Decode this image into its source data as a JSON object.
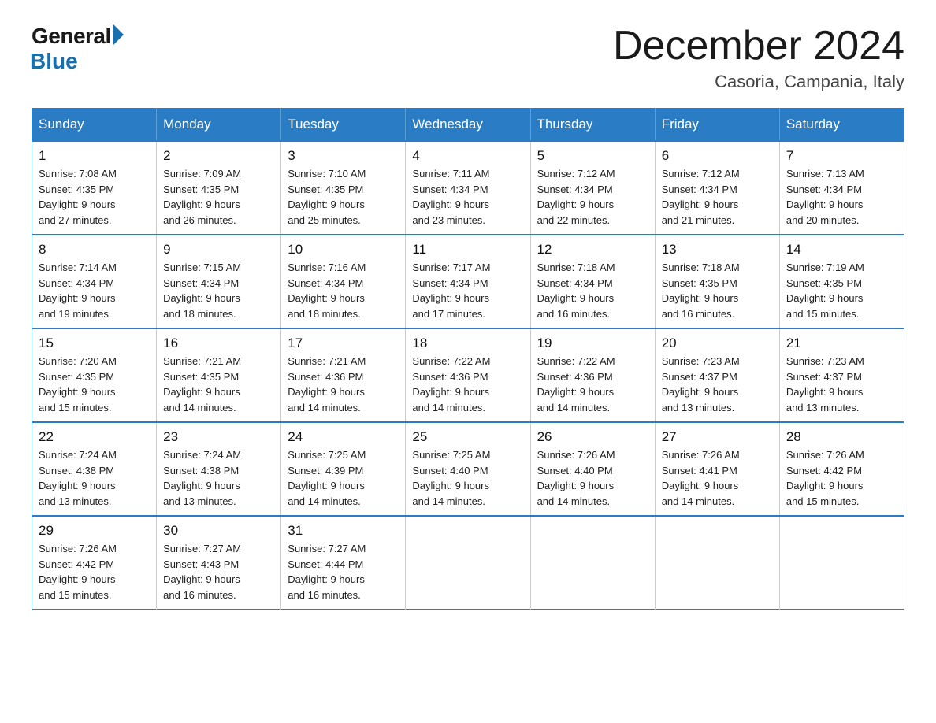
{
  "header": {
    "logo_general": "General",
    "logo_blue": "Blue",
    "month_title": "December 2024",
    "location": "Casoria, Campania, Italy"
  },
  "days_of_week": [
    "Sunday",
    "Monday",
    "Tuesday",
    "Wednesday",
    "Thursday",
    "Friday",
    "Saturday"
  ],
  "weeks": [
    [
      {
        "day": "1",
        "sunrise": "7:08 AM",
        "sunset": "4:35 PM",
        "daylight": "9 hours and 27 minutes."
      },
      {
        "day": "2",
        "sunrise": "7:09 AM",
        "sunset": "4:35 PM",
        "daylight": "9 hours and 26 minutes."
      },
      {
        "day": "3",
        "sunrise": "7:10 AM",
        "sunset": "4:35 PM",
        "daylight": "9 hours and 25 minutes."
      },
      {
        "day": "4",
        "sunrise": "7:11 AM",
        "sunset": "4:34 PM",
        "daylight": "9 hours and 23 minutes."
      },
      {
        "day": "5",
        "sunrise": "7:12 AM",
        "sunset": "4:34 PM",
        "daylight": "9 hours and 22 minutes."
      },
      {
        "day": "6",
        "sunrise": "7:12 AM",
        "sunset": "4:34 PM",
        "daylight": "9 hours and 21 minutes."
      },
      {
        "day": "7",
        "sunrise": "7:13 AM",
        "sunset": "4:34 PM",
        "daylight": "9 hours and 20 minutes."
      }
    ],
    [
      {
        "day": "8",
        "sunrise": "7:14 AM",
        "sunset": "4:34 PM",
        "daylight": "9 hours and 19 minutes."
      },
      {
        "day": "9",
        "sunrise": "7:15 AM",
        "sunset": "4:34 PM",
        "daylight": "9 hours and 18 minutes."
      },
      {
        "day": "10",
        "sunrise": "7:16 AM",
        "sunset": "4:34 PM",
        "daylight": "9 hours and 18 minutes."
      },
      {
        "day": "11",
        "sunrise": "7:17 AM",
        "sunset": "4:34 PM",
        "daylight": "9 hours and 17 minutes."
      },
      {
        "day": "12",
        "sunrise": "7:18 AM",
        "sunset": "4:34 PM",
        "daylight": "9 hours and 16 minutes."
      },
      {
        "day": "13",
        "sunrise": "7:18 AM",
        "sunset": "4:35 PM",
        "daylight": "9 hours and 16 minutes."
      },
      {
        "day": "14",
        "sunrise": "7:19 AM",
        "sunset": "4:35 PM",
        "daylight": "9 hours and 15 minutes."
      }
    ],
    [
      {
        "day": "15",
        "sunrise": "7:20 AM",
        "sunset": "4:35 PM",
        "daylight": "9 hours and 15 minutes."
      },
      {
        "day": "16",
        "sunrise": "7:21 AM",
        "sunset": "4:35 PM",
        "daylight": "9 hours and 14 minutes."
      },
      {
        "day": "17",
        "sunrise": "7:21 AM",
        "sunset": "4:36 PM",
        "daylight": "9 hours and 14 minutes."
      },
      {
        "day": "18",
        "sunrise": "7:22 AM",
        "sunset": "4:36 PM",
        "daylight": "9 hours and 14 minutes."
      },
      {
        "day": "19",
        "sunrise": "7:22 AM",
        "sunset": "4:36 PM",
        "daylight": "9 hours and 14 minutes."
      },
      {
        "day": "20",
        "sunrise": "7:23 AM",
        "sunset": "4:37 PM",
        "daylight": "9 hours and 13 minutes."
      },
      {
        "day": "21",
        "sunrise": "7:23 AM",
        "sunset": "4:37 PM",
        "daylight": "9 hours and 13 minutes."
      }
    ],
    [
      {
        "day": "22",
        "sunrise": "7:24 AM",
        "sunset": "4:38 PM",
        "daylight": "9 hours and 13 minutes."
      },
      {
        "day": "23",
        "sunrise": "7:24 AM",
        "sunset": "4:38 PM",
        "daylight": "9 hours and 13 minutes."
      },
      {
        "day": "24",
        "sunrise": "7:25 AM",
        "sunset": "4:39 PM",
        "daylight": "9 hours and 14 minutes."
      },
      {
        "day": "25",
        "sunrise": "7:25 AM",
        "sunset": "4:40 PM",
        "daylight": "9 hours and 14 minutes."
      },
      {
        "day": "26",
        "sunrise": "7:26 AM",
        "sunset": "4:40 PM",
        "daylight": "9 hours and 14 minutes."
      },
      {
        "day": "27",
        "sunrise": "7:26 AM",
        "sunset": "4:41 PM",
        "daylight": "9 hours and 14 minutes."
      },
      {
        "day": "28",
        "sunrise": "7:26 AM",
        "sunset": "4:42 PM",
        "daylight": "9 hours and 15 minutes."
      }
    ],
    [
      {
        "day": "29",
        "sunrise": "7:26 AM",
        "sunset": "4:42 PM",
        "daylight": "9 hours and 15 minutes."
      },
      {
        "day": "30",
        "sunrise": "7:27 AM",
        "sunset": "4:43 PM",
        "daylight": "9 hours and 16 minutes."
      },
      {
        "day": "31",
        "sunrise": "7:27 AM",
        "sunset": "4:44 PM",
        "daylight": "9 hours and 16 minutes."
      },
      null,
      null,
      null,
      null
    ]
  ],
  "labels": {
    "sunrise_prefix": "Sunrise: ",
    "sunset_prefix": "Sunset: ",
    "daylight_prefix": "Daylight: "
  }
}
